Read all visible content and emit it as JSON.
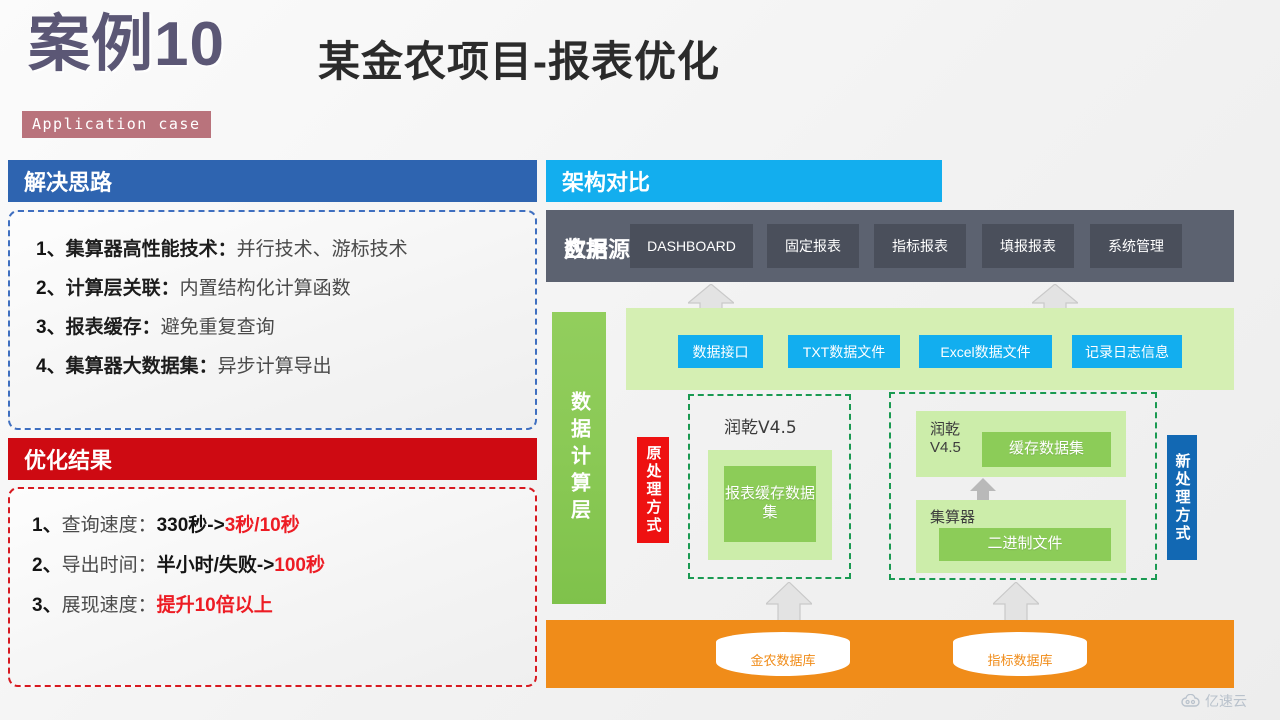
{
  "header": {
    "case_no": "案例10",
    "badge": "Application case",
    "title": "某金农项目-报表优化"
  },
  "left": {
    "solution": {
      "heading": "解决思路",
      "items": [
        {
          "num": "1、",
          "bold": "集算器高性能技术",
          "sep": "：",
          "rest": "并行技术、游标技术"
        },
        {
          "num": "2、",
          "bold": "计算层关联",
          "sep": "：",
          "rest": "内置结构化计算函数"
        },
        {
          "num": "3、",
          "bold": "报表缓存",
          "sep": "：",
          "rest": "避免重复查询"
        },
        {
          "num": "4、",
          "bold": "集算器大数据集",
          "sep": "：",
          "rest": "异步计算导出"
        }
      ]
    },
    "results": {
      "heading": "优化结果",
      "items": [
        {
          "num": "1、",
          "label": "查询速度：",
          "black": "330秒->",
          "red": "3秒/10秒"
        },
        {
          "num": "2、",
          "label": "导出时间：",
          "black": "半小时/失败->",
          "red": "100秒"
        },
        {
          "num": "3、",
          "label": "展现速度：",
          "black": "",
          "red": "提升10倍以上"
        }
      ]
    }
  },
  "right": {
    "heading": "架构对比",
    "app_layer": {
      "label": "应用",
      "chips": [
        "DASHBOARD",
        "固定报表",
        "指标报表",
        "填报报表",
        "系统管理"
      ]
    },
    "compute_layer": {
      "label": "数据计算层",
      "interfaces": [
        "数据接口",
        "TXT数据文件",
        "Excel数据文件",
        "记录日志信息"
      ],
      "old_tag": "原处理方式",
      "new_tag": "新处理方式",
      "old_box": {
        "title": "润乾V4.5",
        "inner": "报表缓存数据集"
      },
      "new_box": {
        "runqian_title": "润乾\nV4.5",
        "runqian_inner": "缓存数据集",
        "esproc_title": "集算器",
        "esproc_inner": "二进制文件"
      }
    },
    "source_layer": {
      "label": "数据源",
      "databases": [
        "金农数据库",
        "指标数据库"
      ]
    }
  },
  "watermark": {
    "text": "亿速云"
  },
  "colors": {
    "case_purple": "#5b5775",
    "badge_rose": "#b9737c",
    "panel_blue": "#2e64b0",
    "panel_red": "#ce0a12",
    "panel_cyan": "#13aeee",
    "app_gray": "#5c6270",
    "chip_gray": "#4a4f5b",
    "green_bar": "#8ac955",
    "light_green": "#d5efb3",
    "blue_chip": "#12aeef",
    "dash_green": "#1a9a52",
    "tag_red": "#ee1111",
    "tag_blue": "#1268b3",
    "orange": "#f08c19",
    "highlight_red": "#ed1c24"
  }
}
